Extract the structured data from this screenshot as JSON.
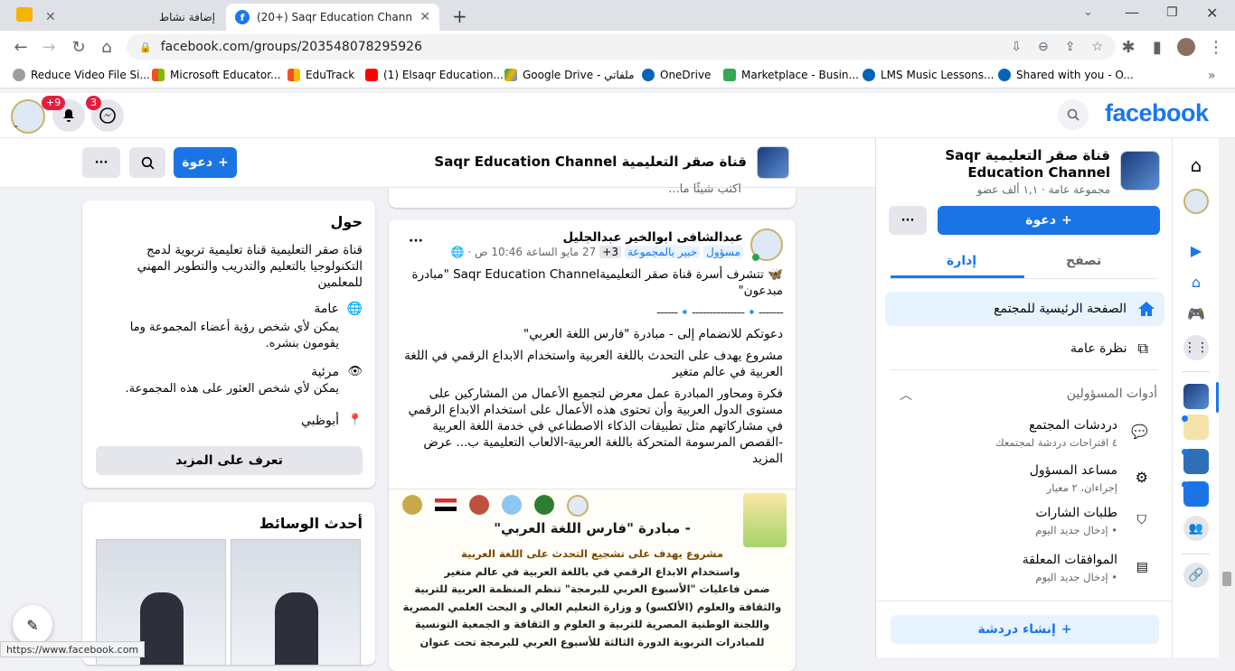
{
  "browser": {
    "tabs": [
      {
        "label": "إضافة نشاط"
      },
      {
        "label": "(20+) Saqr Education Channel قناة صقر التعليمية"
      }
    ],
    "url": "facebook.com/groups/203548078295926",
    "bookmarks": [
      "Reduce Video File Si...",
      "Microsoft Educator...",
      "EduTrack",
      "(1) Elsaqr Education...",
      "Google Drive - ملفاتي",
      "OneDrive",
      "Marketplace - Busin...",
      "LMS Music Lessons...",
      "Shared with you - O..."
    ],
    "status_url": "https://www.facebook.com"
  },
  "fb": {
    "logo": "facebook",
    "notif_badge": "+9",
    "messenger_badge": "3"
  },
  "group": {
    "name": "قناة صقر التعليمية Saqr Education Channel",
    "invite": "دعوة",
    "meta": "مجموعة عامة · ١,١ ألف عضو"
  },
  "post": {
    "composer_placeholder": "اكتب شيئًا ما...",
    "author": "عبدالشافى ابوالخير عبدالجليل",
    "role_admin": "مسؤول",
    "role_expert": "خبير بالمجموعة",
    "role_more": "+3",
    "time": "27 مايو الساعة 10:46 ص ·",
    "p1": "🦋 تتشرف أسرة قناة صقر التعليميةSaqr Education Channel \"مبادرة مبدعون\"",
    "divider": "-------🔹---------------🔹------",
    "p2": "دعوتكم للانضمام إلى - مبادرة \"فارس اللغة العربي\"",
    "p3": "مشروع يهدف على التحدث باللغة العربية واستخدام الابداع الرقمي في اللغة العربية في عالم متغير",
    "p4": "فكرة ومحاور المبادرة عمل معرض لتجميع الأعمال من المشاركين على مستوى الدول العربية وأن تحتوى هذه الأعمال على استخدام الابداع الرقمي في مشاركاتهم مثل تطبيقات الذكاء الاصطناعي في خدمة اللغة العربية -القصص المرسومة المتحركة باللغة العربية-الالعاب التعليمية ب... عرض المزيد",
    "img_title": "- مبادرة \"فارس اللغة العربي\"",
    "img_l1": "مشروع يهدف على تشجيع التحدث على اللغة العربية",
    "img_l2": "واستخدام الابداع الرقمي في باللغة العربية في عالم متغير",
    "img_l3": "ضمن فاعليات \"الأسبوع العربي للبرمجة\" تنظم المنظمة العربية للتربية",
    "img_l4": "والثقافة والعلوم (الألكسو) و وزارة التعليم العالي و البحث العلمي المصرية",
    "img_l5": "واللجنة الوطنية المصرية للتربية و العلوم و الثقافة و الجمعية التونسية",
    "img_l6": "للمبادرات التربوية الدورة الثالثة للأسبوع العربي للبرمجة تحت عنوان"
  },
  "about": {
    "title": "حول",
    "desc": "قناة صقر التعليمية قناة تعليمية تربوية لدمج التكنولوجيا بالتعليم والتدريب والتطوير المهني للمعلمين",
    "public_t": "عامة",
    "public_d": "يمكن لأي شخص رؤية أعضاء المجموعة وما يقومون بنشره.",
    "visible_t": "مرئية",
    "visible_d": "يمكن لأي شخص العثور على هذه المجموعة.",
    "location": "أبوظبي",
    "learn_more": "تعرف على المزيد"
  },
  "media": {
    "title": "أحدث الوسائط"
  },
  "side": {
    "name": "قناة صقر التعليمية Saqr Education Channel",
    "meta": "مجموعة عامة · ١,١ ألف عضو",
    "invite": "دعوة",
    "tab_browse": "تصفح",
    "tab_manage": "إدارة",
    "home": "الصفحة الرئيسية للمجتمع",
    "overview": "نظرة عامة",
    "admin_tools": "أدوات المسؤولين",
    "chats": "دردشات المجتمع",
    "chats_sub": "٤ اقتراحات دردشة لمجتمعك",
    "assistant": "مساعد المسؤول",
    "assistant_sub": "إجراءان، ٢ معيار",
    "badges": "طلبات الشارات",
    "badges_sub": "• إدخال جديد اليوم",
    "pending": "الموافقات المعلقة",
    "pending_sub": "• إدخال جديد اليوم",
    "create_chat": "إنشاء دردشة"
  }
}
